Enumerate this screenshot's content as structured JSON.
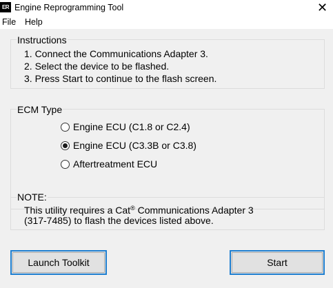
{
  "window": {
    "icon_text": "ER",
    "title": "Engine Reprogramming Tool",
    "close_glyph": "✕"
  },
  "menu": {
    "items": [
      "File",
      "Help"
    ]
  },
  "instructions": {
    "label": "Instructions",
    "lines": [
      "1. Connect the Communications Adapter 3.",
      "2. Select the device to be flashed.",
      "3. Press Start to continue to the flash screen."
    ]
  },
  "ecm_type": {
    "label": "ECM Type",
    "options": [
      {
        "label": "Engine ECU (C1.8 or C2.4)",
        "selected": false
      },
      {
        "label": "Engine ECU (C3.3B or C3.8)",
        "selected": true
      },
      {
        "label": "Aftertreatment ECU",
        "selected": false
      }
    ]
  },
  "note": {
    "label": "NOTE:",
    "line1_prefix": "This utility requires a Cat",
    "line1_mark": "®",
    "line1_suffix": " Communications Adapter 3",
    "line2": "(317-7485) to flash the devices listed above."
  },
  "buttons": {
    "launch_toolkit": "Launch Toolkit",
    "start": "Start"
  },
  "colors": {
    "focus_border": "#1f7fd0",
    "client_bg": "#f0f0f0"
  }
}
